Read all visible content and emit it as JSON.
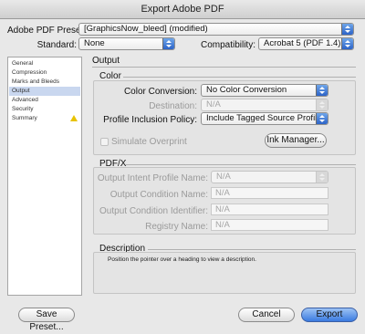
{
  "window": {
    "title": "Export Adobe PDF"
  },
  "header": {
    "preset_label": "Adobe PDF Preset:",
    "preset_value": "[GraphicsNow_bleed] (modified)",
    "standard_label": "Standard:",
    "standard_value": "None",
    "compatibility_label": "Compatibility:",
    "compatibility_value": "Acrobat 5 (PDF 1.4)"
  },
  "sidebar": {
    "items": [
      {
        "label": "General"
      },
      {
        "label": "Compression"
      },
      {
        "label": "Marks and Bleeds"
      },
      {
        "label": "Output"
      },
      {
        "label": "Advanced"
      },
      {
        "label": "Security"
      },
      {
        "label": "Summary"
      }
    ],
    "selected": "Output"
  },
  "output": {
    "heading": "Output",
    "color": {
      "title": "Color",
      "conversion_label": "Color Conversion:",
      "conversion_value": "No Color Conversion",
      "destination_label": "Destination:",
      "destination_value": "N/A",
      "profile_policy_label": "Profile Inclusion Policy:",
      "profile_policy_value": "Include Tagged Source Profiles",
      "simulate_overprint_label": "Simulate Overprint",
      "ink_manager_label": "Ink Manager..."
    },
    "pdfx": {
      "title": "PDF/X",
      "intent_profile_label": "Output Intent Profile Name:",
      "intent_profile_value": "N/A",
      "condition_name_label": "Output Condition Name:",
      "condition_name_value": "N/A",
      "condition_identifier_label": "Output Condition Identifier:",
      "condition_identifier_value": "N/A",
      "registry_label": "Registry Name:",
      "registry_value": "N/A"
    },
    "description": {
      "title": "Description",
      "text": "Position the pointer over a heading to view a description."
    }
  },
  "footer": {
    "save_preset_label": "Save Preset...",
    "cancel_label": "Cancel",
    "export_label": "Export"
  },
  "colors": {
    "accent": "#3a7be0",
    "selection": "#c9d7ef",
    "warning": "#e8c200"
  },
  "icons": {
    "summary_warning": "warning-triangle-icon",
    "popup_arrow": "popup-arrows-icon"
  }
}
